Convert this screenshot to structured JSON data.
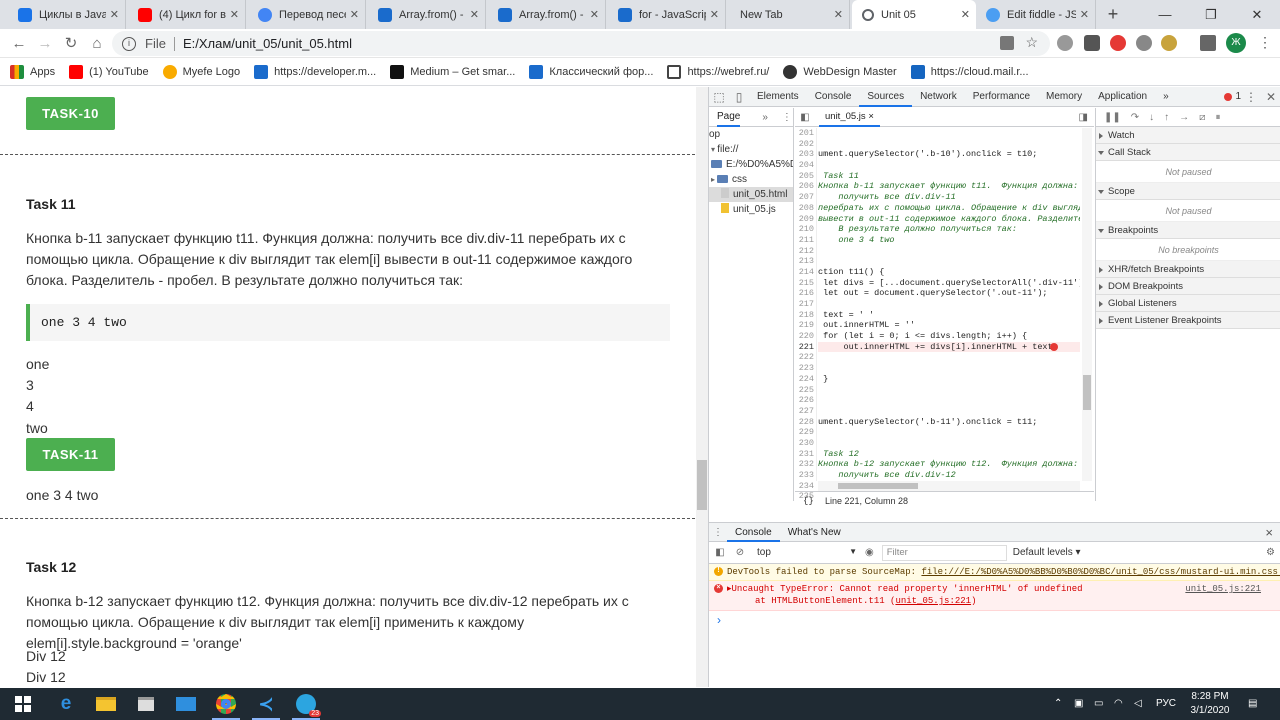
{
  "browser": {
    "tabs": [
      {
        "title": "Циклы в JavaSc",
        "color": "#1a73e8"
      },
      {
        "title": "(4) Цикл for в J",
        "color": "#ff0000"
      },
      {
        "title": "Перевод песен",
        "color": "#4285f4"
      },
      {
        "title": "Array.from() - J",
        "color": "#1a6bcc"
      },
      {
        "title": "Array.from() - J",
        "color": "#1a6bcc"
      },
      {
        "title": "for - JavaScript",
        "color": "#1a6bcc"
      },
      {
        "title": "New Tab",
        "color": "#dee1e6"
      },
      {
        "title": "Unit 05",
        "color": "#5f6368"
      },
      {
        "title": "Edit fiddle - JSF",
        "color": "#4b9ef2"
      }
    ],
    "new_tab": "+",
    "window_controls": {
      "minimize": "—",
      "restore": "❐",
      "close": "✕"
    },
    "address": {
      "scheme": "File",
      "url": "E:/Хлам/unit_05/unit_05.html"
    },
    "profile_initials": "Ж"
  },
  "bookmarks": [
    {
      "label": "Apps",
      "color": "#d93025"
    },
    {
      "label": "(1) YouTube",
      "color": "#ff0000"
    },
    {
      "label": "Myefe Logo",
      "color": "#f9ab00"
    },
    {
      "label": "https://developer.m...",
      "color": "#1a6bcc"
    },
    {
      "label": "Medium – Get smar...",
      "color": "#111111"
    },
    {
      "label": "Классический фор...",
      "color": "#1a6bcc"
    },
    {
      "label": "https://webref.ru/",
      "color": "#444444"
    },
    {
      "label": "WebDesign Master",
      "color": "#333333"
    },
    {
      "label": "https://cloud.mail.r...",
      "color": "#1565c0"
    }
  ],
  "page": {
    "task10_button": "TASK-10",
    "task11": {
      "heading": "Task 11",
      "description": "Кнопка b-11 запускает функцию t11. Функция должна: получить все div.div-11 перебрать их с помощью цикла. Обращение к div выглядит так elem[i] вывести в out-11 содержимое каждого блока. Разделитель - пробел. В результате должно получиться так:",
      "code": "one 3 4 two",
      "divs": [
        "one",
        "3",
        "4",
        "two"
      ],
      "button": "TASK-11",
      "output": "one 3 4 two"
    },
    "task12": {
      "heading": "Task 12",
      "description": "Кнопка b-12 запускает функцию t12. Функция должна: получить все div.div-12 перебрать их с помощью цикла. Обращение к div выглядит так elem[i] применить к каждому elem[i].style.background = 'orange'",
      "divs": [
        "Div 12",
        "Div 12"
      ]
    }
  },
  "devtools": {
    "tabs": [
      "Elements",
      "Console",
      "Sources",
      "Network",
      "Performance",
      "Memory",
      "Application"
    ],
    "active_tab": "Sources",
    "more": "»",
    "error_count": "1",
    "navigator": {
      "tab": "Page",
      "more": "»",
      "items": [
        {
          "label": "op",
          "kind": "plain"
        },
        {
          "label": "file://",
          "kind": "plain"
        },
        {
          "label": "E:/%D0%A5%D0%",
          "kind": "folder"
        },
        {
          "label": "css",
          "kind": "folder"
        },
        {
          "label": "unit_05.html",
          "kind": "file"
        },
        {
          "label": "unit_05.js",
          "kind": "jsfile"
        }
      ]
    },
    "editor": {
      "filename": "unit_05.js",
      "close": "×",
      "lines": [
        {
          "n": "201",
          "t": "",
          "cls": ""
        },
        {
          "n": "202",
          "t": "",
          "cls": ""
        },
        {
          "n": "203",
          "t": "ument.querySelector('.b-10').onclick = t10;",
          "cls": ""
        },
        {
          "n": "204",
          "t": "",
          "cls": ""
        },
        {
          "n": "205",
          "t": " Task 11",
          "cls": "cm"
        },
        {
          "n": "206",
          "t": "Кнопка b-11 запускает функцию t11.  Функция должна:",
          "cls": "cm"
        },
        {
          "n": "207",
          "t": "    получить все div.div-11",
          "cls": "cm"
        },
        {
          "n": "208",
          "t": "перебрать их с помощью цикла. Обращение к div выгляди",
          "cls": "cm"
        },
        {
          "n": "209",
          "t": "вывести в out-11 содержимое каждого блока. Разделител",
          "cls": "cm"
        },
        {
          "n": "210",
          "t": "    В результате должно получиться так:",
          "cls": "cm"
        },
        {
          "n": "211",
          "t": "    one 3 4 two",
          "cls": "cm"
        },
        {
          "n": "212",
          "t": "",
          "cls": ""
        },
        {
          "n": "213",
          "t": "",
          "cls": ""
        },
        {
          "n": "214",
          "t": "ction t11() {",
          "cls": ""
        },
        {
          "n": "215",
          "t": " let divs = [...document.querySelectorAll('.div-11')]",
          "cls": ""
        },
        {
          "n": "216",
          "t": " let out = document.querySelector('.out-11');",
          "cls": ""
        },
        {
          "n": "217",
          "t": "",
          "cls": ""
        },
        {
          "n": "218",
          "t": " text = ' '",
          "cls": ""
        },
        {
          "n": "219",
          "t": " out.innerHTML = ''",
          "cls": ""
        },
        {
          "n": "220",
          "t": " for (let i = 0; i <= divs.length; i++) {",
          "cls": ""
        },
        {
          "n": "221",
          "t": "     out.innerHTML += divs[i].innerHTML + text;",
          "cls": "hl"
        },
        {
          "n": "222",
          "t": "",
          "cls": ""
        },
        {
          "n": "223",
          "t": "",
          "cls": ""
        },
        {
          "n": "224",
          "t": " }",
          "cls": ""
        },
        {
          "n": "225",
          "t": "",
          "cls": ""
        },
        {
          "n": "226",
          "t": "",
          "cls": ""
        },
        {
          "n": "227",
          "t": "",
          "cls": ""
        },
        {
          "n": "228",
          "t": "ument.querySelector('.b-11').onclick = t11;",
          "cls": ""
        },
        {
          "n": "229",
          "t": "",
          "cls": ""
        },
        {
          "n": "230",
          "t": "",
          "cls": ""
        },
        {
          "n": "231",
          "t": " Task 12",
          "cls": "cm"
        },
        {
          "n": "232",
          "t": "Кнопка b-12 запускает функцию t12.  Функция должна:",
          "cls": "cm"
        },
        {
          "n": "233",
          "t": "    получить все div.div-12",
          "cls": "cm"
        },
        {
          "n": "234",
          "t": "перебрать их с помощью цикла. Обращение к div выгляди",
          "cls": "cm"
        },
        {
          "n": "235",
          "t": "",
          "cls": ""
        }
      ],
      "status": "Line 221, Column 28"
    },
    "debugger": {
      "watch": "Watch",
      "call_stack": "Call Stack",
      "call_stack_state": "Not paused",
      "scope": "Scope",
      "scope_state": "Not paused",
      "breakpoints": "Breakpoints",
      "breakpoints_state": "No breakpoints",
      "xhr": "XHR/fetch Breakpoints",
      "dom": "DOM Breakpoints",
      "global": "Global Listeners",
      "event": "Event Listener Breakpoints"
    },
    "drawer": {
      "tabs": [
        "Console",
        "What's New"
      ],
      "close": "×",
      "context": "top",
      "filter_placeholder": "Filter",
      "levels": "Default levels ▾",
      "warning": {
        "text": "DevTools failed to parse SourceMap: ",
        "link": "file:///E:/%D0%A5%D0%BB%D0%B0%D0%BC/unit_05/css/mustard-ui.min.css.map"
      },
      "error": {
        "text": "▸Uncaught TypeError: Cannot read property 'innerHTML' of undefined",
        "trace": "at HTMLButtonElement.t11 (",
        "trace_link": "unit_05.js:221",
        "trace_end": ")",
        "source": "unit_05.js:221"
      },
      "prompt": "›"
    }
  },
  "taskbar": {
    "language": "РУС",
    "time": "8:28 PM",
    "date": "3/1/2020",
    "badge": "23"
  }
}
